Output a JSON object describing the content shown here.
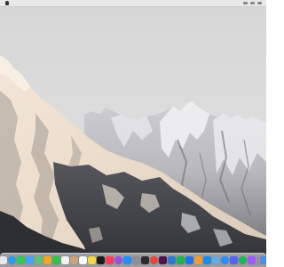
{
  "desktop": {
    "wallpaper": "snowy-mountain-wallpaper",
    "colors": {
      "sky": "#dadada",
      "mountain_light": "#ececec",
      "mountain_shadow": "#6f6f74",
      "forest": "#3d3f44",
      "sunlit_slope": "#f1ddc8"
    }
  },
  "menubar": {
    "icons": [
      "apple-icon",
      "status-icons"
    ]
  },
  "dock": {
    "items": [
      {
        "icon": "finder-icon",
        "color": "#3b82f6"
      },
      {
        "icon": "launchpad-icon",
        "color": "#e5e7eb"
      },
      {
        "icon": "safari-icon",
        "color": "#2f9bf0"
      },
      {
        "icon": "messages-icon",
        "color": "#34c759"
      },
      {
        "icon": "mail-icon",
        "color": "#4aa3f0"
      },
      {
        "icon": "maps-icon",
        "color": "#62c07a"
      },
      {
        "icon": "photos-icon",
        "color": "#f5a623"
      },
      {
        "icon": "facetime-icon",
        "color": "#30c150"
      },
      {
        "icon": "calendar-icon",
        "color": "#f2f2f2"
      },
      {
        "icon": "contacts-icon",
        "color": "#c9a27a"
      },
      {
        "icon": "reminders-icon",
        "color": "#f8f8f8"
      },
      {
        "icon": "notes-icon",
        "color": "#f7d548"
      },
      {
        "icon": "tv-icon",
        "color": "#1c1c1e"
      },
      {
        "icon": "music-icon",
        "color": "#fa3c5a"
      },
      {
        "icon": "podcasts-icon",
        "color": "#9b51e0"
      },
      {
        "icon": "app-store-icon",
        "color": "#1e90ff"
      },
      {
        "icon": "system-settings-icon",
        "color": "#8e8e93"
      },
      {
        "icon": "terminal-icon",
        "color": "#2c2c2e"
      },
      {
        "icon": "chrome-icon",
        "color": "#e8453c"
      },
      {
        "icon": "slack-icon",
        "color": "#4a154b"
      },
      {
        "icon": "vscode-icon",
        "color": "#2b7bd0"
      },
      {
        "icon": "numbers-icon",
        "color": "#21b24b"
      },
      {
        "icon": "keynote-icon",
        "color": "#1d74e8"
      },
      {
        "icon": "pages-icon",
        "color": "#f39c2f"
      },
      {
        "icon": "xcode-icon",
        "color": "#1a8cf0"
      },
      {
        "icon": "preview-icon",
        "color": "#6fa8dc"
      },
      {
        "icon": "zoom-icon",
        "color": "#2d8cff"
      },
      {
        "icon": "discord-icon",
        "color": "#5865f2"
      },
      {
        "icon": "spotify-icon",
        "color": "#1db954"
      },
      {
        "icon": "figma-icon",
        "color": "#a259ff"
      }
    ],
    "trailing": [
      {
        "icon": "downloads-icon",
        "color": "#4a90e2"
      },
      {
        "icon": "trash-icon",
        "color": "#c8c8c8"
      }
    ]
  }
}
